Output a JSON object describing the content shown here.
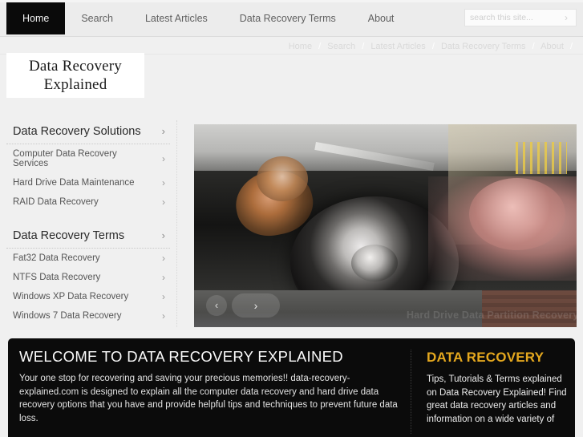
{
  "nav": {
    "items": [
      {
        "label": "Home",
        "active": true
      },
      {
        "label": "Search",
        "active": false
      },
      {
        "label": "Latest Articles",
        "active": false
      },
      {
        "label": "Data Recovery Terms",
        "active": false
      },
      {
        "label": "About",
        "active": false
      }
    ]
  },
  "search": {
    "placeholder": "search this site...",
    "value": "",
    "submit_icon": "›"
  },
  "breadcrumb": {
    "items": [
      "Home",
      "Search",
      "Latest Articles",
      "Data Recovery Terms",
      "About"
    ],
    "separator": "/"
  },
  "logo": {
    "line1": "Data Recovery",
    "line2": "Explained"
  },
  "sidebar": {
    "groups": [
      {
        "heading": "Data Recovery Solutions",
        "items": [
          "Computer Data Recovery Services",
          "Hard Drive Data Maintenance",
          "RAID Data Recovery"
        ]
      },
      {
        "heading": "Data Recovery Terms",
        "items": [
          "Fat32 Data Recovery",
          "NTFS Data Recovery",
          "Windows XP Data Recovery",
          "Windows 7 Data Recovery"
        ]
      }
    ],
    "chevron_icon": "›"
  },
  "slider": {
    "caption": "Hard Drive Data Partition Recovery",
    "prev_icon": "‹",
    "next_icon": "›"
  },
  "panel": {
    "welcome_title": "WELCOME TO DATA RECOVERY EXPLAINED",
    "welcome_body": "Your one stop for recovering and saving your precious memories!! data-recovery-explained.com is designed to explain all the computer data recovery and hard drive data recovery options that you have and provide helpful tips and techniques to prevent future data loss.",
    "side_title": "DATA RECOVERY",
    "side_body": "Tips, Tutorials & Terms explained on Data Recovery Explained! Find great data recovery articles and information on a wide variety of",
    "accent_color": "#e5a81e"
  }
}
